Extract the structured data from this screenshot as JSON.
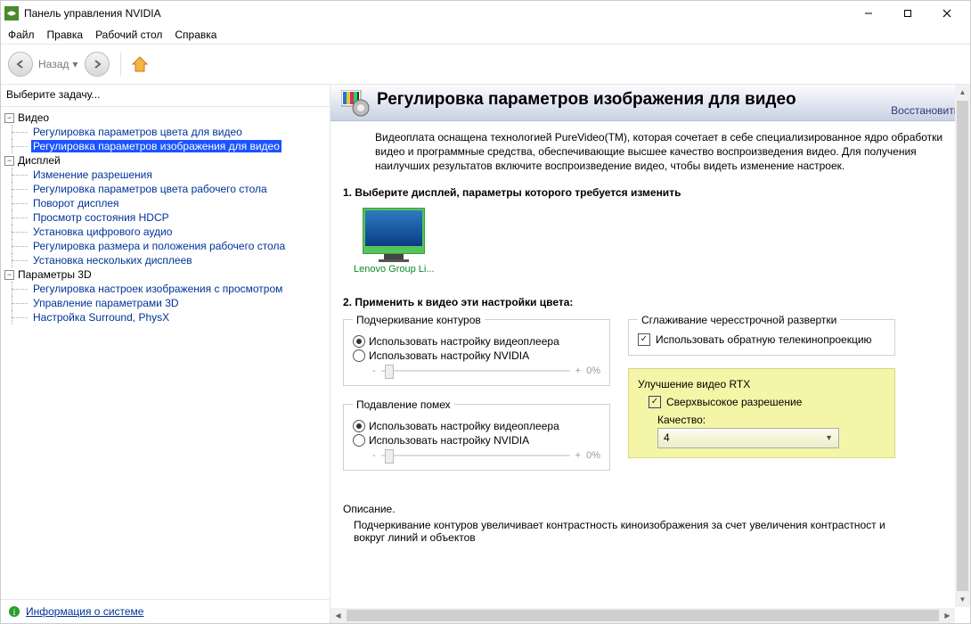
{
  "window": {
    "title": "Панель управления NVIDIA"
  },
  "menu": {
    "file": "Файл",
    "edit": "Правка",
    "desktop": "Рабочий стол",
    "help": "Справка"
  },
  "toolbar": {
    "back": "Назад"
  },
  "sidebar": {
    "pick_task": "Выберите задачу...",
    "video": "Видео",
    "video_items": [
      "Регулировка параметров цвета для видео",
      "Регулировка параметров изображения для видео"
    ],
    "display": "Дисплей",
    "display_items": [
      "Изменение разрешения",
      "Регулировка параметров цвета рабочего стола",
      "Поворот дисплея",
      "Просмотр состояния HDCP",
      "Установка цифрового аудио",
      "Регулировка размера и положения рабочего стола",
      "Установка нескольких дисплеев"
    ],
    "params3d": "Параметры 3D",
    "params3d_items": [
      "Регулировка настроек изображения с просмотром",
      "Управление параметрами 3D",
      "Настройка Surround, PhysX"
    ],
    "sysinfo": "Информация о системе"
  },
  "page": {
    "title": "Регулировка параметров изображения для видео",
    "restore": "Восстановить",
    "intro": "Видеоплата оснащена технологией PureVideo(TM), которая сочетает в себе специализированное ядро обработки видео и программные средства, обеспечивающие высшее качество воспроизведения видео. Для получения наилучших результатов включите воспроизведение видео, чтобы видеть изменение настроек.",
    "step1": "1. Выберите дисплей, параметры которого требуется изменить",
    "monitor": "Lenovo Group Li...",
    "step2": "2. Применить к видео эти настройки цвета:",
    "edge_title": "Подчеркивание контуров",
    "use_player": "Использовать настройку видеоплеера",
    "use_nvidia": "Использовать настройку NVIDIA",
    "slider_minus": "-",
    "slider_plus": "+",
    "slider_val": "0%",
    "noise_title": "Подавление помех",
    "deint_title": "Сглаживание чересстрочной развертки",
    "deint_check": "Использовать обратную телекинопроекцию",
    "rtx_title": "Улучшение видео RTX",
    "rtx_check": "Сверхвысокое разрешение",
    "quality_label": "Качество:",
    "quality_value": "4",
    "desc_label": "Описание.",
    "desc_text": "Подчеркивание контуров увеличивает контрастность киноизображения за счет увеличения контрастност и вокруг линий и объектов"
  }
}
